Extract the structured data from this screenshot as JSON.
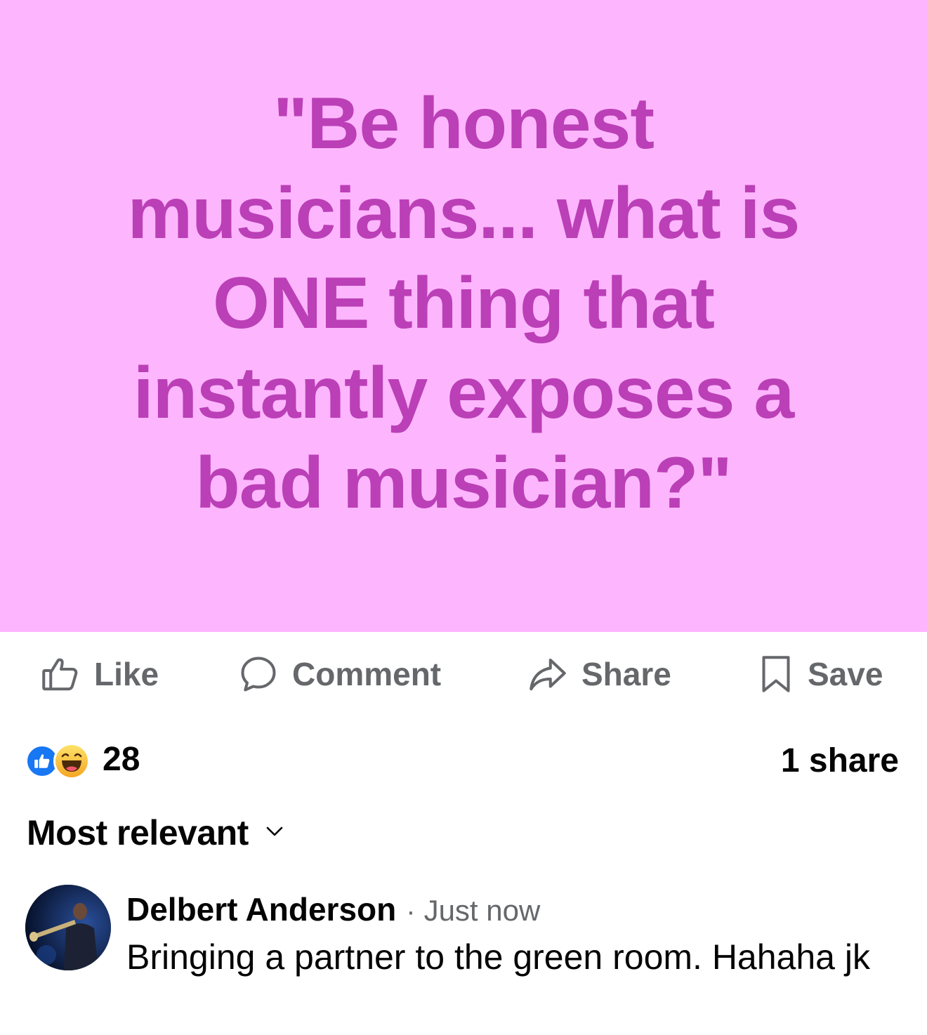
{
  "post": {
    "text": "\"Be honest musicians... what is ONE thing that instantly exposes a bad musician?\"",
    "background_color": "#fdb6fd",
    "text_color": "#bb3fb7"
  },
  "actions": {
    "like": {
      "label": "Like",
      "icon": "thumbs-up-outline-icon"
    },
    "comment": {
      "label": "Comment",
      "icon": "comment-bubble-icon"
    },
    "share": {
      "label": "Share",
      "icon": "share-arrow-icon"
    },
    "save": {
      "label": "Save",
      "icon": "bookmark-icon"
    }
  },
  "stats": {
    "reactions": [
      "like-reaction-icon",
      "haha-reaction-icon"
    ],
    "reaction_count": "28",
    "share_count": "1 share"
  },
  "comments_sort": {
    "label": "Most relevant",
    "icon": "chevron-down-icon"
  },
  "comments": [
    {
      "author": "Delbert Anderson",
      "separator": "·",
      "time": "Just now",
      "text": "Bringing a partner to the green room. Hahaha jk"
    }
  ],
  "colors": {
    "secondary_text": "#65676b",
    "primary_text": "#050505",
    "like_blue": "#1877f2"
  }
}
